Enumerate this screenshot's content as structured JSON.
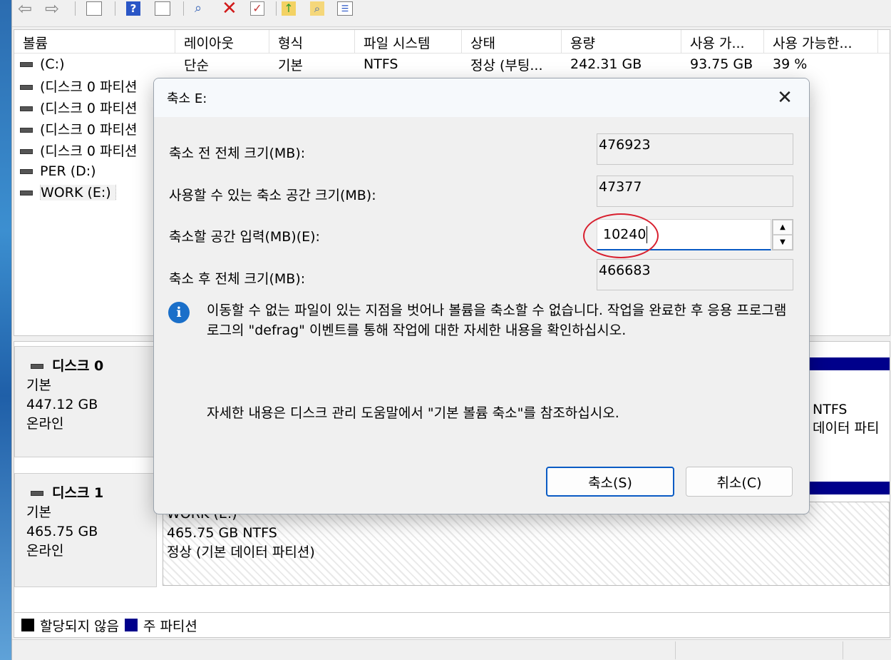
{
  "toolbar": {
    "icons": [
      "back-arrow-icon",
      "forward-arrow-icon",
      "console-tree-icon",
      "help-icon",
      "action-pane-icon",
      "connect-icon",
      "delete-icon",
      "properties-icon",
      "up-folder-icon",
      "search-icon",
      "list-icon"
    ],
    "help_glyph": "?"
  },
  "volume_list": {
    "columns": [
      "볼륨",
      "레이아웃",
      "형식",
      "파일 시스템",
      "상태",
      "용량",
      "사용 가...",
      "사용 가능한..."
    ],
    "rows": [
      {
        "name": "(C:)",
        "layout": "단순",
        "type": "기본",
        "fs": "NTFS",
        "status": "정상 (부팅...",
        "capacity": "242.31 GB",
        "free": "93.75 GB",
        "pct": "39 %"
      },
      {
        "name": "(디스크 0 파티션",
        "layout": "",
        "type": "",
        "fs": "",
        "status": "",
        "capacity": "",
        "free": "",
        "pct": ""
      },
      {
        "name": "(디스크 0 파티션",
        "layout": "",
        "type": "",
        "fs": "",
        "status": "",
        "capacity": "",
        "free": "",
        "pct": ""
      },
      {
        "name": "(디스크 0 파티션",
        "layout": "",
        "type": "",
        "fs": "",
        "status": "",
        "capacity": "",
        "free": "",
        "pct": ""
      },
      {
        "name": "(디스크 0 파티션",
        "layout": "",
        "type": "",
        "fs": "",
        "status": "",
        "capacity": "",
        "free": "",
        "pct": ""
      },
      {
        "name": "PER (D:)",
        "layout": "",
        "type": "",
        "fs": "",
        "status": "",
        "capacity": "",
        "free": "",
        "pct": ""
      },
      {
        "name": "WORK (E:)",
        "layout": "",
        "type": "",
        "fs": "",
        "status": "",
        "capacity": "",
        "free": "",
        "pct": ""
      }
    ]
  },
  "disks": [
    {
      "title": "디스크 0",
      "type": "기본",
      "size": "447.12 GB",
      "state": "온라인",
      "visible_partition": {
        "fs": "NTFS",
        "status": "데이터 파티"
      }
    },
    {
      "title": "디스크 1",
      "type": "기본",
      "size": "465.75 GB",
      "state": "온라인",
      "visible_partition": {
        "name": "WORK (E:)",
        "size_fs": "465.75 GB NTFS",
        "status": "정상 (기본 데이터 파티션)"
      }
    }
  ],
  "legend": {
    "items": [
      {
        "label": "할당되지 않음",
        "color": "#000000"
      },
      {
        "label": "주 파티션",
        "color": "#00008b"
      }
    ]
  },
  "dialog": {
    "title": "축소 E:",
    "close_glyph": "✕",
    "fields": {
      "total_before_label": "축소 전 전체 크기(MB):",
      "total_before_value": "476923",
      "available_label": "사용할 수 있는 축소 공간 크기(MB):",
      "available_value": "47377",
      "shrink_label": "축소할 공간 입력(MB)(E):",
      "shrink_value": "10240",
      "total_after_label": "축소 후 전체 크기(MB):",
      "total_after_value": "466683"
    },
    "info_glyph": "i",
    "info_text": "이동할 수 없는 파일이 있는 지점을 벗어나 볼륨을 축소할 수 없습니다. 작업을 완료한 후 응용 프로그램 로그의 \"defrag\" 이벤트를 통해 작업에 대한 자세한 내용을 확인하십시오.",
    "help_text": "자세한 내용은 디스크 관리 도움말에서 \"기본 볼륨 축소\"를 참조하십시오.",
    "shrink_button": "축소(S)",
    "cancel_button": "취소(C)",
    "accent_color": "#0a5bc4",
    "highlight_color": "#d8202f"
  }
}
